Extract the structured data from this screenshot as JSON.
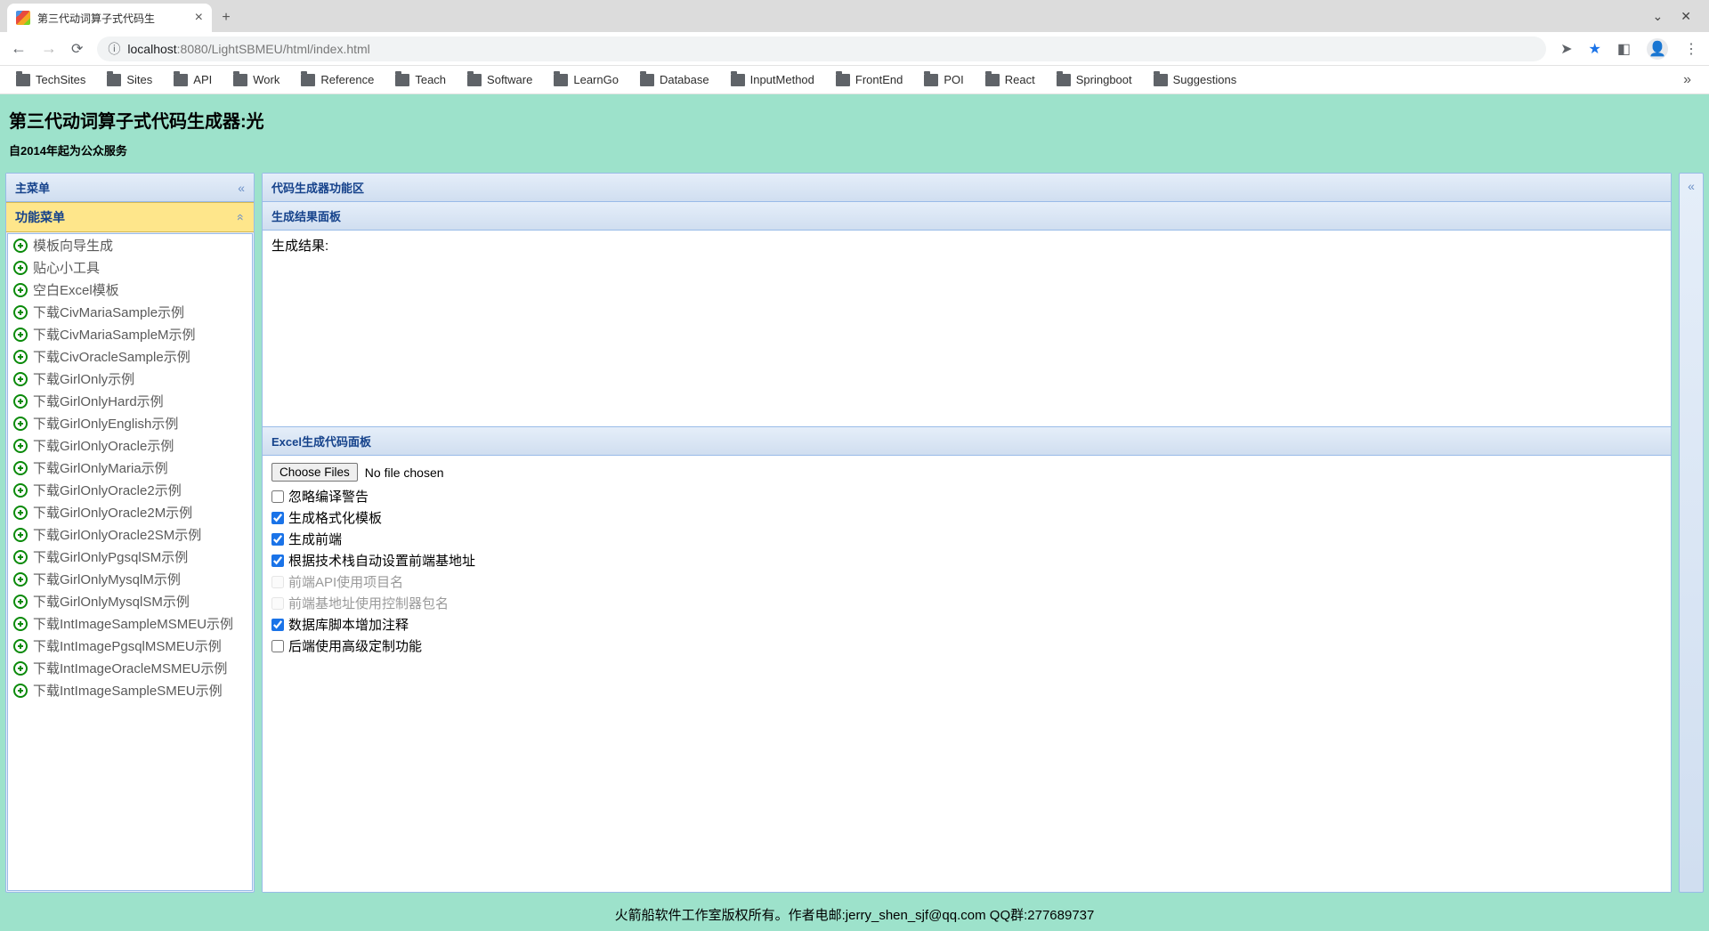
{
  "browser": {
    "tab_title": "第三代动词算子式代码生",
    "url_host": "localhost",
    "url_port": ":8080",
    "url_path": "/LightSBMEU/html/index.html"
  },
  "bookmarks": [
    "TechSites",
    "Sites",
    "API",
    "Work",
    "Reference",
    "Teach",
    "Software",
    "LearnGo",
    "Database",
    "InputMethod",
    "FrontEnd",
    "POI",
    "React",
    "Springboot",
    "Suggestions"
  ],
  "app": {
    "title": "第三代动词算子式代码生成器:光",
    "subtitle": "自2014年起为公众服务"
  },
  "sidebar": {
    "main_menu_label": "主菜单",
    "func_menu_label": "功能菜单",
    "items": [
      "模板向导生成",
      "贴心小工具",
      "空白Excel模板",
      "下载CivMariaSample示例",
      "下载CivMariaSampleM示例",
      "下载CivOracleSample示例",
      "下载GirlOnly示例",
      "下载GirlOnlyHard示例",
      "下载GirlOnlyEnglish示例",
      "下载GirlOnlyOracle示例",
      "下载GirlOnlyMaria示例",
      "下载GirlOnlyOracle2示例",
      "下载GirlOnlyOracle2M示例",
      "下载GirlOnlyOracle2SM示例",
      "下载GirlOnlyPgsqlSM示例",
      "下载GirlOnlyMysqlM示例",
      "下载GirlOnlyMysqlSM示例",
      "下载IntImageSampleMSMEU示例",
      "下载IntImagePgsqlMSMEU示例",
      "下载IntImageOracleMSMEU示例",
      "下载IntImageSampleSMEU示例"
    ]
  },
  "main": {
    "region_title": "代码生成器功能区",
    "result_panel_title": "生成结果面板",
    "result_label": "生成结果:",
    "excel_panel_title": "Excel生成代码面板",
    "file_button": "Choose Files",
    "file_status": "No file chosen",
    "options": [
      {
        "label": "忽略编译警告",
        "checked": false,
        "disabled": false
      },
      {
        "label": "生成格式化模板",
        "checked": true,
        "disabled": false
      },
      {
        "label": "生成前端",
        "checked": true,
        "disabled": false
      },
      {
        "label": "根据技术栈自动设置前端基地址",
        "checked": true,
        "disabled": false
      },
      {
        "label": "前端API使用项目名",
        "checked": false,
        "disabled": true
      },
      {
        "label": "前端基地址使用控制器包名",
        "checked": false,
        "disabled": true
      },
      {
        "label": "数据库脚本增加注释",
        "checked": true,
        "disabled": false
      },
      {
        "label": "后端使用高级定制功能",
        "checked": false,
        "disabled": false
      }
    ]
  },
  "footer": "火箭船软件工作室版权所有。作者电邮:jerry_shen_sjf@qq.com QQ群:277689737"
}
